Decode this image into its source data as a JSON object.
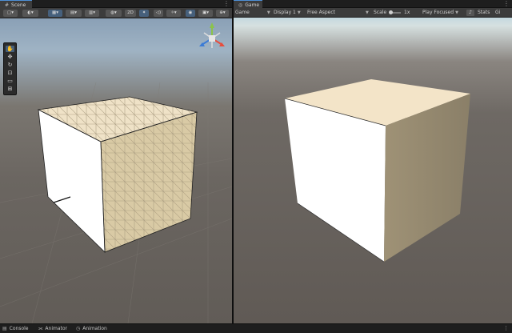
{
  "scene_panel": {
    "tab_label": "Scene",
    "tab_icon": "hash-icon",
    "toolbar": {
      "mode_2d_label": "2D"
    },
    "tools": [
      "hand-tool-icon",
      "move-tool-icon",
      "rotate-tool-icon",
      "scale-tool-icon",
      "rect-tool-icon",
      "transform-tool-icon"
    ],
    "gizmo_label": "",
    "cube_color_top": "#efe2c7",
    "cube_color_left": "#ffffff",
    "cube_color_right": "#d9caa5"
  },
  "game_panel": {
    "tab_label": "Game",
    "tab_icon": "gamepad-icon",
    "toolbar": {
      "view_label": "Game",
      "display_label": "Display 1",
      "aspect_label": "Free Aspect",
      "scale_label": "Scale",
      "scale_value": "1x",
      "play_mode_label": "Play Focused",
      "stats_label": "Stats",
      "gizmos_label": "Gi"
    },
    "cube_color_top": "#f3e4c8",
    "cube_color_left": "#ffffff",
    "cube_color_right": "#968a70"
  },
  "bottom_tabs": [
    {
      "label": "Console",
      "icon": "console-icon"
    },
    {
      "label": "Animator",
      "icon": "animator-icon"
    },
    {
      "label": "Animation",
      "icon": "animation-icon"
    }
  ]
}
